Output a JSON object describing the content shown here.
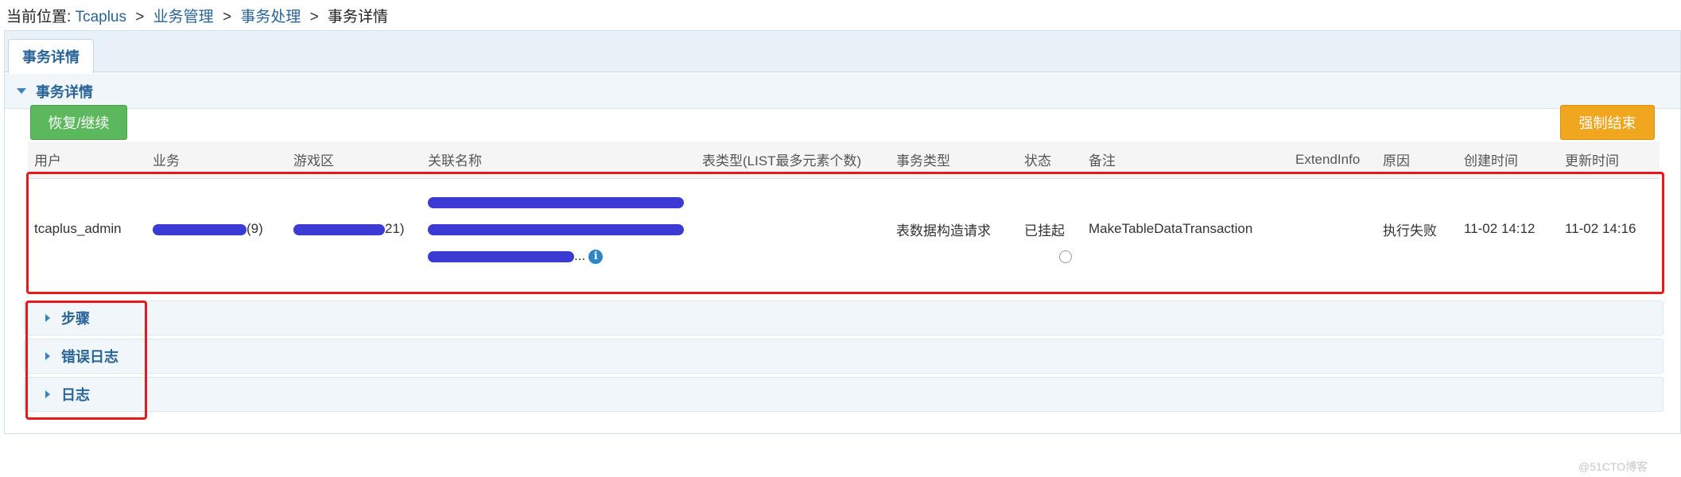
{
  "breadcrumb": {
    "prefix": "当前位置:",
    "items": [
      "Tcaplus",
      "业务管理",
      "事务处理",
      "事务详情"
    ],
    "separator": ">"
  },
  "tab": {
    "label": "事务详情"
  },
  "panel": {
    "title": "事务详情"
  },
  "buttons": {
    "resume": "恢复/继续",
    "force_end": "强制结束"
  },
  "table": {
    "headers": [
      "用户",
      "业务",
      "游戏区",
      "关联名称",
      "表类型(LIST最多元素个数)",
      "事务类型",
      "状态",
      "备注",
      "ExtendInfo",
      "原因",
      "创建时间",
      "更新时间"
    ],
    "row": {
      "user": "tcaplus_admin",
      "business_suffix": "(9)",
      "zone_suffix": "21)",
      "names_ellipsis": "...",
      "table_type": "",
      "tx_type": "表数据构造请求",
      "status": "已挂起",
      "remark": "MakeTableDataTransaction",
      "extend_info": "",
      "reason": "执行失败",
      "created": "11-02 14:12",
      "updated": "11-02 14:16"
    }
  },
  "sections": [
    "步骤",
    "错误日志",
    "日志"
  ],
  "watermark": "@51CTO博客",
  "icons": {
    "info": "info-icon",
    "radio": "radio-icon",
    "expand": "caret-right-icon",
    "collapse": "caret-down-icon"
  },
  "colors": {
    "accent": "#2a6496",
    "success": "#5cb85c",
    "warning": "#f0a61e",
    "highlight": "#e8191a"
  }
}
